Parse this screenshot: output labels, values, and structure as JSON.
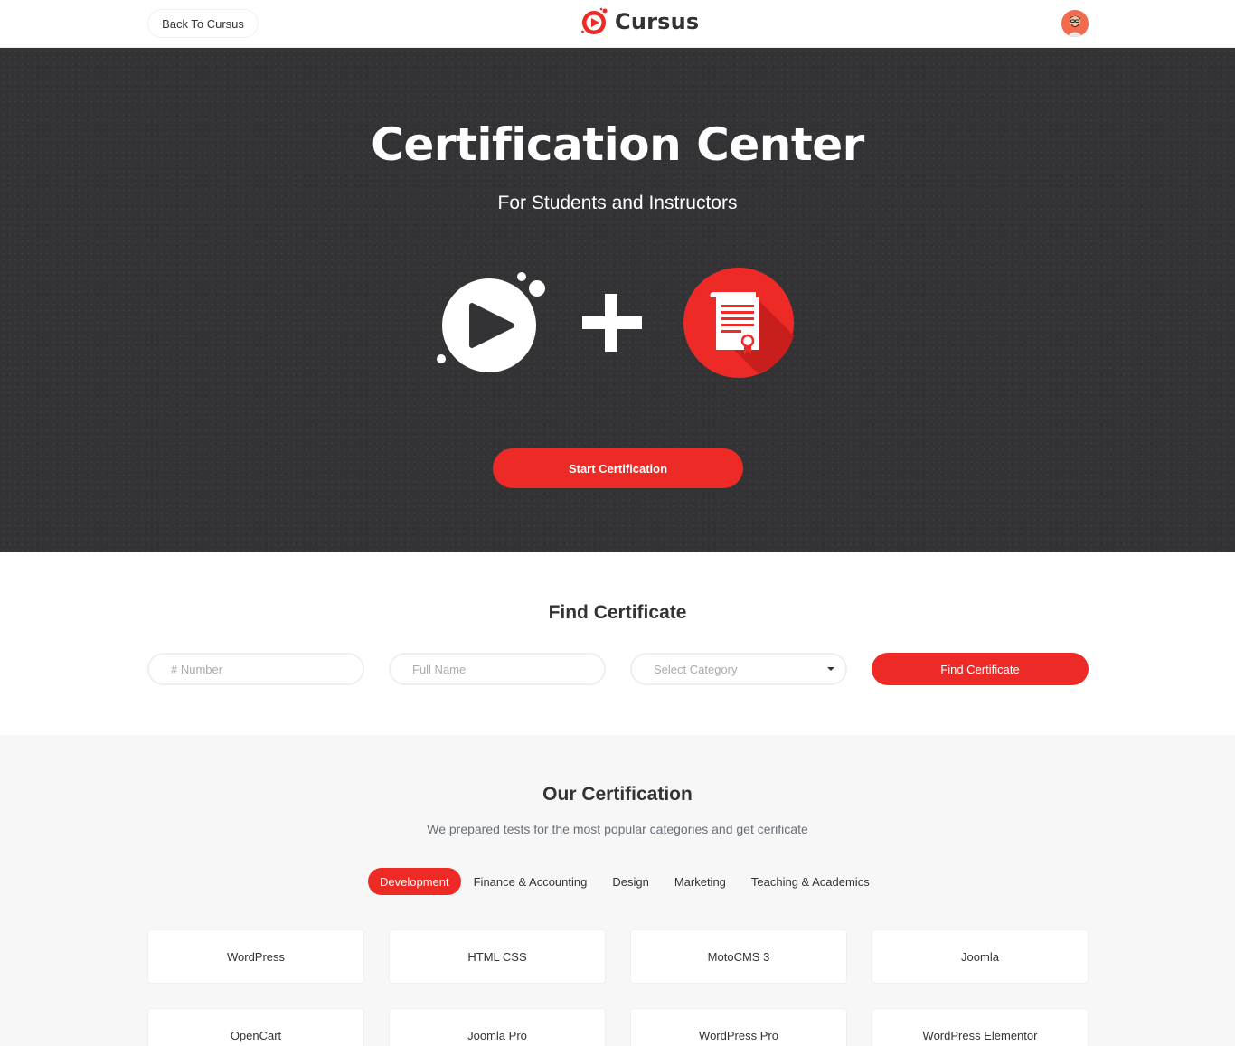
{
  "header": {
    "back_label": "Back To Cursus",
    "logo_text": "Cursus",
    "avatar_icon": "user-avatar"
  },
  "hero": {
    "title": "Certification Center",
    "subtitle": "For Students and Instructors",
    "start_label": "Start Certification",
    "icons": [
      "play-logo-icon",
      "plus-icon",
      "certificate-icon"
    ]
  },
  "find": {
    "title": "Find Certificate",
    "number_placeholder": "# Number",
    "name_placeholder": "Full Name",
    "category_placeholder": "Select Category",
    "button_label": "Find Certificate"
  },
  "certification": {
    "title": "Our Certification",
    "description": "We prepared tests for the most popular categories and get cerificate",
    "tabs": [
      "Development",
      "Finance & Accounting",
      "Design",
      "Marketing",
      "Teaching & Academics"
    ],
    "active_tab": "Development",
    "cards": [
      "WordPress",
      "HTML CSS",
      "MotoCMS 3",
      "Joomla",
      "OpenCart",
      "Joomla Pro",
      "WordPress Pro",
      "WordPress Elementor"
    ]
  },
  "colors": {
    "accent": "#ed2a26",
    "hero_bg": "#333336",
    "page_bg": "#f7f7f7"
  }
}
